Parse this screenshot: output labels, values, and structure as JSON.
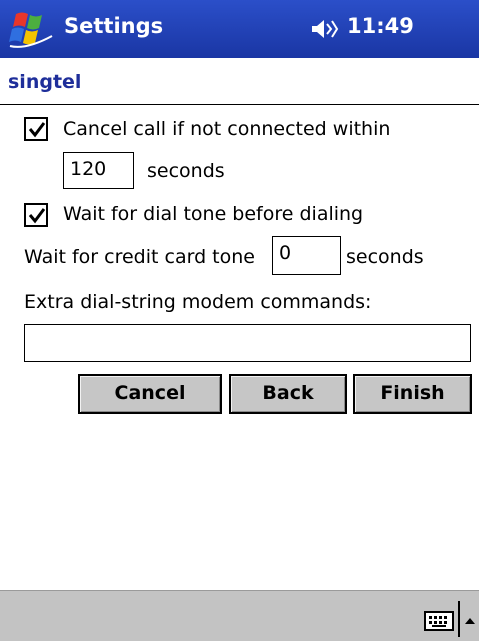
{
  "title_bar": {
    "title": "Settings",
    "time": "11:49"
  },
  "page": {
    "header": "singtel"
  },
  "form": {
    "cancel_call": {
      "checked": true,
      "label": "Cancel call if not connected within",
      "value": "120",
      "unit": "seconds"
    },
    "wait_dial_tone": {
      "checked": true,
      "label": "Wait for dial tone before dialing"
    },
    "credit_card_tone": {
      "label": "Wait for credit card tone",
      "value": "0",
      "unit": "seconds"
    },
    "extra_commands": {
      "label": "Extra dial-string modem commands:",
      "value": ""
    }
  },
  "buttons": {
    "cancel": "Cancel",
    "back": "Back",
    "finish": "Finish"
  },
  "icons": {
    "start": "windows-flag-icon",
    "volume": "speaker-icon",
    "input_panel": "keyboard-icon",
    "input_menu": "arrow-up-icon"
  },
  "colors": {
    "title_bar": "#1f3fb5",
    "header_text": "#1e2e9a",
    "button_face": "#c6c6c6",
    "bottom_bar": "#c3c3c3"
  }
}
